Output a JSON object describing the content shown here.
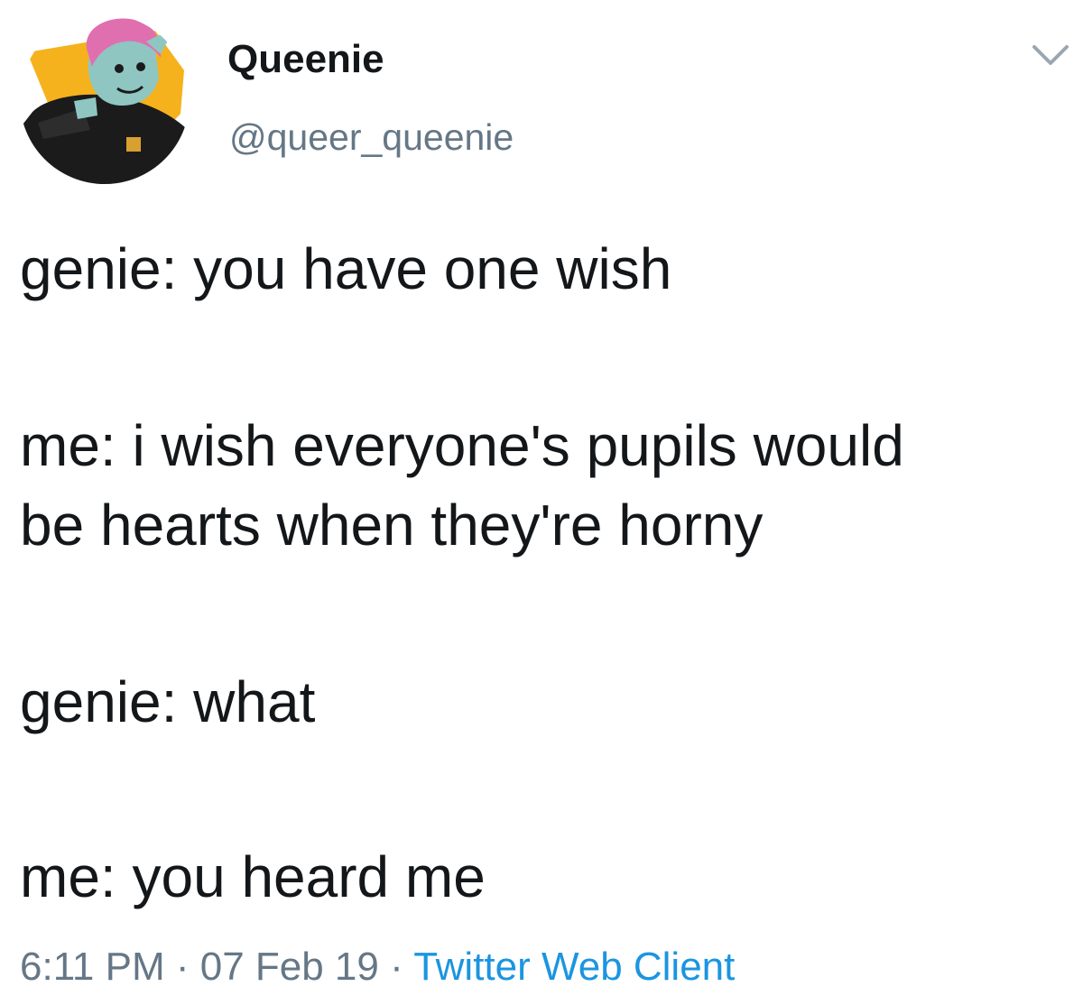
{
  "tweet": {
    "author": {
      "display_name": "Queenie",
      "handle": "@queer_queenie",
      "avatar_icon": "avatar-illustration"
    },
    "menu_icon": "chevron-down-icon",
    "lines": [
      "genie: you have one wish",
      "me: i wish everyone's pupils would",
      "be hearts when they're horny",
      "genie: what",
      "me: you heard me"
    ],
    "meta": {
      "time": "6:11 PM",
      "separator": " · ",
      "date": "07 Feb 19",
      "client": "Twitter Web Client"
    }
  },
  "colors": {
    "text": "#14171a",
    "secondary": "#657786",
    "link": "#1b95e0",
    "avatar_accent": "#f5b21c"
  }
}
